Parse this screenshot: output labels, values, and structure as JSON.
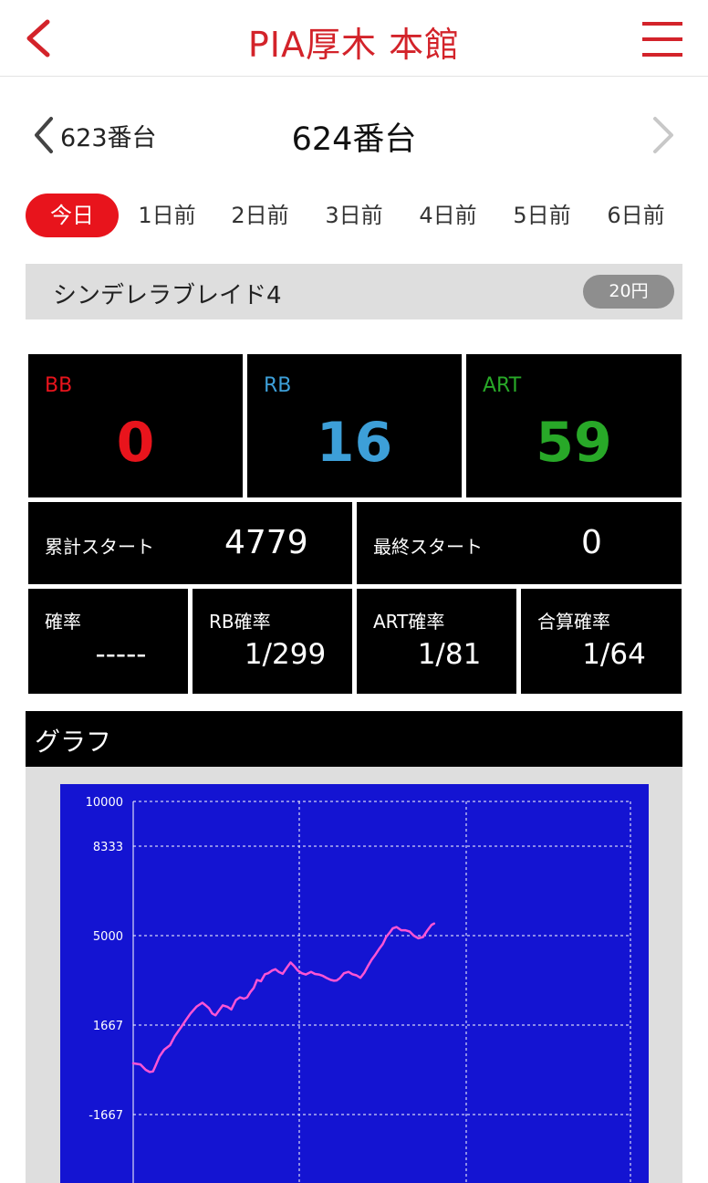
{
  "header": {
    "title": "PIA厚木 本館",
    "back_icon": "chevron-left-icon",
    "menu_icon": "hamburger-menu-icon",
    "accent": "#d3232a"
  },
  "machine_nav": {
    "prev_label": "623番台",
    "current_label": "624番台"
  },
  "days": [
    "今日",
    "1日前",
    "2日前",
    "3日前",
    "4日前",
    "5日前",
    "6日前"
  ],
  "model": {
    "name": "シンデレラブレイド4",
    "rate": "20円"
  },
  "counters": [
    {
      "label": "BB",
      "value": "0",
      "color": "#e8141c"
    },
    {
      "label": "RB",
      "value": "16",
      "color": "#3d9fd8"
    },
    {
      "label": "ART",
      "value": "59",
      "color": "#28a828"
    }
  ],
  "starts": {
    "total_label": "累計スタート",
    "total_value": "4779",
    "last_label": "最終スタート",
    "last_value": "0"
  },
  "probabilities": [
    {
      "label": "確率",
      "value": "-----"
    },
    {
      "label": "RB確率",
      "value": "1/299"
    },
    {
      "label": "ART確率",
      "value": "1/81"
    },
    {
      "label": "合算確率",
      "value": "1/64"
    }
  ],
  "graph": {
    "title": "グラフ"
  },
  "chart_data": {
    "type": "line",
    "y_ticks": [
      "10000",
      "8333",
      "5000",
      "1667",
      "-1667"
    ],
    "ylim": [
      -3000,
      10000
    ],
    "xlim": [
      0,
      4779
    ],
    "grid": true,
    "colors": {
      "background": "#1414d2",
      "line": "#ff55d4",
      "grid": "#ffffff"
    },
    "x": [
      0,
      110,
      190,
      250,
      300,
      330,
      400,
      470,
      560,
      630,
      730,
      800,
      870,
      960,
      1050,
      1100,
      1150,
      1200,
      1250,
      1300,
      1360,
      1430,
      1490,
      1560,
      1620,
      1680,
      1730,
      1780,
      1830,
      1880,
      1940,
      2000,
      2050,
      2110,
      2160,
      2210,
      2270,
      2330,
      2390,
      2450,
      2500,
      2560,
      2620,
      2700,
      2760,
      2820,
      2880,
      2940,
      3000,
      3050,
      3090,
      3140,
      3200,
      3270,
      3330,
      3390,
      3450,
      3510,
      3560,
      3620,
      3680,
      3740,
      3790,
      3840,
      3890,
      3940,
      4000,
      4070,
      4130,
      4200,
      4260,
      4330,
      4400,
      4470,
      4530,
      4570
    ],
    "y": [
      240,
      200,
      0,
      -80,
      -60,
      100,
      500,
      750,
      920,
      1250,
      1600,
      1850,
      2100,
      2350,
      2500,
      2400,
      2300,
      2100,
      2030,
      2200,
      2400,
      2350,
      2250,
      2600,
      2700,
      2650,
      2700,
      2900,
      3050,
      3350,
      3300,
      3560,
      3600,
      3700,
      3750,
      3650,
      3580,
      3800,
      4000,
      3850,
      3700,
      3600,
      3550,
      3650,
      3570,
      3550,
      3500,
      3420,
      3350,
      3320,
      3330,
      3420,
      3600,
      3650,
      3560,
      3520,
      3430,
      3620,
      3850,
      4100,
      4300,
      4520,
      4690,
      4950,
      5100,
      5270,
      5320,
      5200,
      5200,
      5150,
      5000,
      4900,
      4950,
      5200,
      5400,
      5450
    ]
  }
}
